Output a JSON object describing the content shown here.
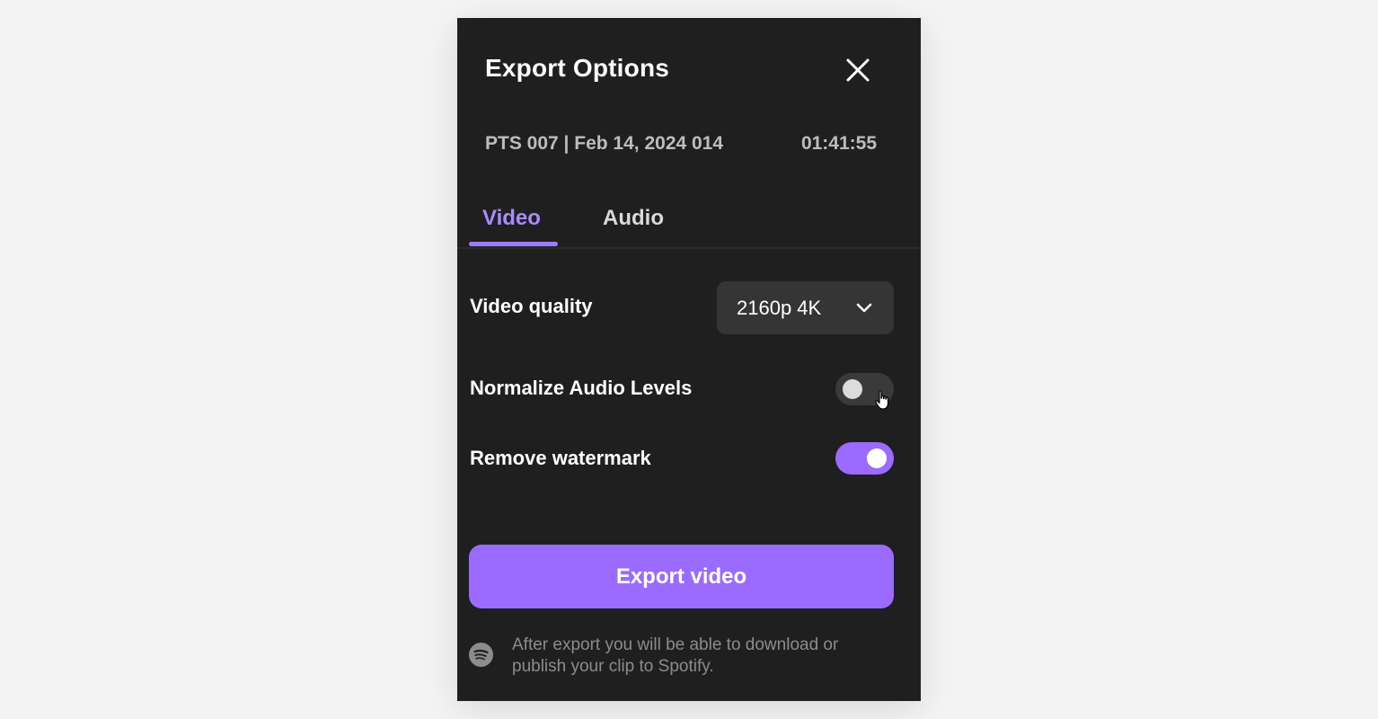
{
  "dialog": {
    "title": "Export Options",
    "close_icon": "close-icon"
  },
  "meta": {
    "episode": "PTS 007 | Feb 14, 2024 014",
    "duration": "01:41:55"
  },
  "tabs": [
    {
      "label": "Video",
      "active": true
    },
    {
      "label": "Audio",
      "active": false
    }
  ],
  "settings": {
    "quality": {
      "label": "Video quality",
      "value": "2160p 4K",
      "icon": "chevron-down-icon"
    },
    "normalize_audio": {
      "label": "Normalize Audio Levels",
      "enabled": false
    },
    "remove_watermark": {
      "label": "Remove watermark",
      "enabled": true
    }
  },
  "export_button": {
    "label": "Export video"
  },
  "footer": {
    "icon": "spotify-icon",
    "text": "After export you will be able to download or publish your clip to Spotify."
  },
  "colors": {
    "accent": "#9b6bff",
    "tab_active": "#a98bff",
    "panel_bg": "#1f1f1f",
    "page_bg": "#f4f4f4"
  }
}
